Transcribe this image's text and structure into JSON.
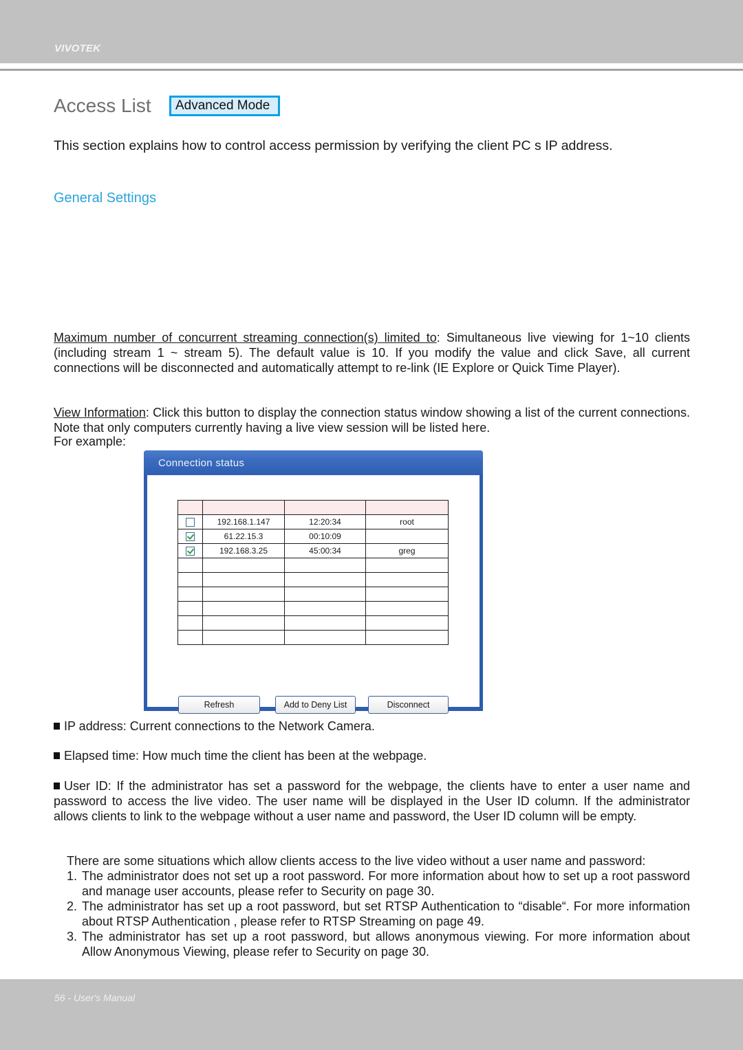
{
  "header": {
    "brand": "VIVOTEK"
  },
  "page": {
    "title": "Access List",
    "mode_badge": "Advanced Mode",
    "intro": "This section explains how to control access permission by verifying the client PC s IP address.",
    "subheading": "General Settings"
  },
  "paragraphs": {
    "max_connections": {
      "term": "Maximum number of concurrent streaming connection(s) limited to",
      "text": ": Simultaneous live viewing for 1~10 clients (including stream 1 ~ stream 5). The default value is 10. If you modify the value and click Save, all current connections will be disconnected and automatically attempt to re-link (IE Explore or Quick Time Player)."
    },
    "view_information": {
      "term": "View Information",
      "text": ": Click this button to display the connection status window showing a list of the current connections. Note that only computers currently having a live view session will be listed here."
    },
    "for_example": "For example:"
  },
  "connection_window": {
    "title": "Connection status",
    "rows": [
      {
        "checked": false,
        "ip": "192.168.1.147",
        "elapsed": "12:20:34",
        "user": "root"
      },
      {
        "checked": true,
        "ip": "61.22.15.3",
        "elapsed": "00:10:09",
        "user": ""
      },
      {
        "checked": true,
        "ip": "192.168.3.25",
        "elapsed": "45:00:34",
        "user": "greg"
      }
    ],
    "empty_rows": 6,
    "buttons": {
      "refresh": "Refresh",
      "add_to_deny": "Add to Deny List",
      "disconnect": "Disconnect"
    }
  },
  "bullets": [
    "IP address: Current connections to the Network Camera.",
    "Elapsed time: How much time the client has been at the webpage.",
    "User ID: If the administrator has set a password for the webpage, the clients have to enter a user name and password to access the live video. The user name will be displayed in the User ID column. If  the administrator allows clients to link to the webpage without a user name and password, the User ID column will be empty."
  ],
  "situations": {
    "intro": "There are some situations which allow clients access to the live video without a user name and password:",
    "items": [
      {
        "num": "1.",
        "text": "The administrator does not set up a root password. For more information about how to set up a root password and manage user accounts, please refer to Security on page 30."
      },
      {
        "num": "2.",
        "text": "The administrator has set up a root password, but set RTSP Authentication   to “disable“. For more information about RTSP Authentication  , please refer to RTSP Streaming on page 49."
      },
      {
        "num": "3.",
        "text": "The administrator has set up a root password, but allows anonymous viewing. For more information about Allow Anonymous Viewing,    please refer to Security on page 30."
      }
    ]
  },
  "footer": {
    "text": "56 - User's Manual"
  }
}
